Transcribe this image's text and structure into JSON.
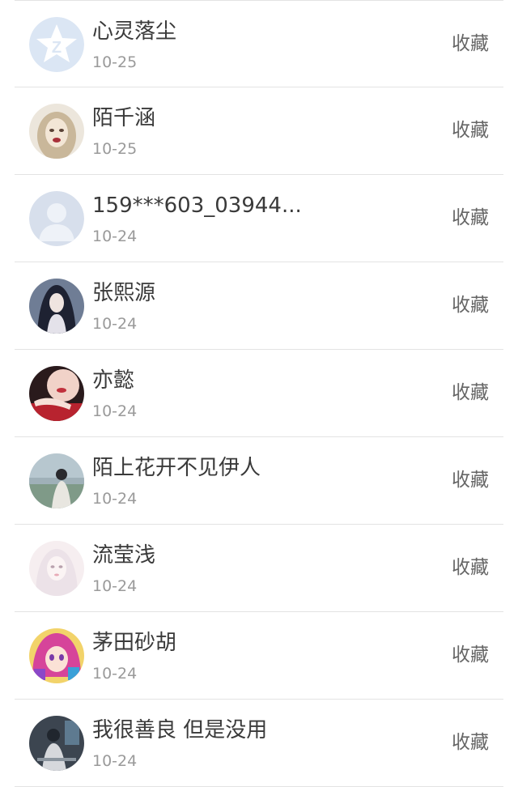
{
  "contacts": [
    {
      "name": "心灵落尘",
      "date": "10-25",
      "action": "收藏",
      "avatar_icon": "qzone-star-icon"
    },
    {
      "name": "陌千涵",
      "date": "10-25",
      "action": "收藏",
      "avatar_icon": "portrait-pale-girl-icon"
    },
    {
      "name": "159***603_03944...",
      "date": "10-24",
      "action": "收藏",
      "avatar_icon": "default-user-silhouette-icon"
    },
    {
      "name": "张熙源",
      "date": "10-24",
      "action": "收藏",
      "avatar_icon": "portrait-dark-hair-girl-icon"
    },
    {
      "name": "亦懿",
      "date": "10-24",
      "action": "收藏",
      "avatar_icon": "portrait-hand-lips-icon"
    },
    {
      "name": "陌上花开不见伊人",
      "date": "10-24",
      "action": "收藏",
      "avatar_icon": "portrait-landscape-girl-icon"
    },
    {
      "name": "流莹浅",
      "date": "10-24",
      "action": "收藏",
      "avatar_icon": "portrait-white-hair-girl-icon"
    },
    {
      "name": "茅田砂胡",
      "date": "10-24",
      "action": "收藏",
      "avatar_icon": "anime-pink-hair-girl-icon"
    },
    {
      "name": "我很善良 但是没用",
      "date": "10-24",
      "action": "收藏",
      "avatar_icon": "portrait-dark-figure-icon"
    }
  ]
}
